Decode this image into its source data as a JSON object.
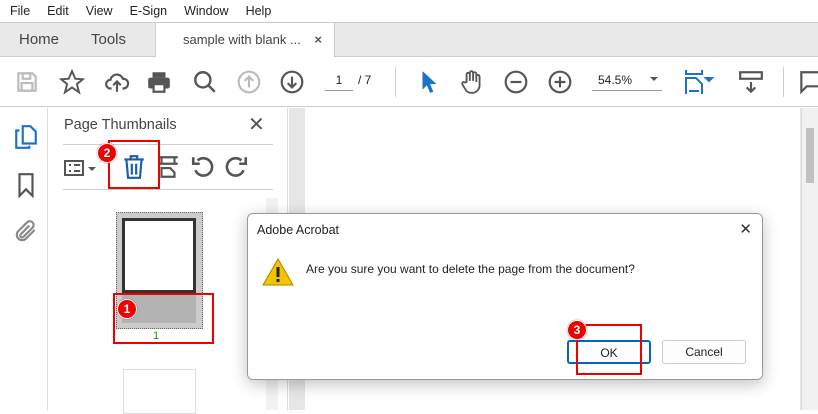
{
  "menu": [
    "File",
    "Edit",
    "View",
    "E-Sign",
    "Window",
    "Help"
  ],
  "tabs": {
    "home": "Home",
    "tools": "Tools",
    "doc": "sample with blank ...",
    "close": "×"
  },
  "toolbar": {
    "page_current": "1",
    "page_total": "/ 7",
    "zoom": "54.5%"
  },
  "panel": {
    "title": "Page Thumbnails",
    "close": "✕",
    "thumb_label": "1"
  },
  "annotations": {
    "b1": "1",
    "b2": "2",
    "b3": "3"
  },
  "dialog": {
    "title": "Adobe Acrobat",
    "close": "✕",
    "message": "Are you sure you want to delete the page from the document?",
    "ok": "OK",
    "cancel": "Cancel"
  },
  "colors": {
    "accent": "#1a73c8",
    "annotation": "#ee0000"
  }
}
